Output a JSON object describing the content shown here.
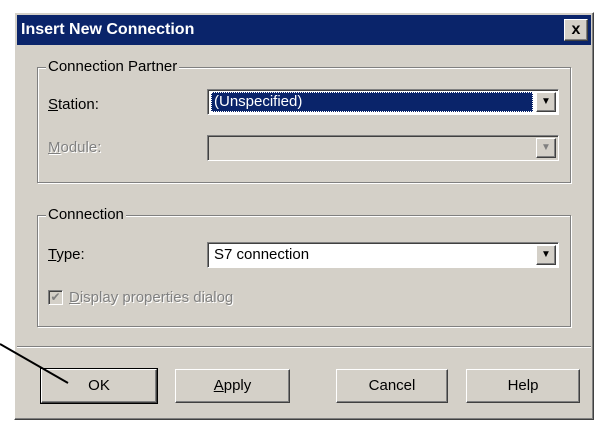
{
  "window": {
    "title": "Insert New Connection",
    "close_glyph": "x"
  },
  "partner_group": {
    "title": "Connection Partner",
    "station": {
      "label_prefix": "",
      "label_access": "S",
      "label_rest": "tation:",
      "value": "(Unspecified)"
    },
    "module": {
      "label_prefix": "",
      "label_access": "M",
      "label_rest": "odule:",
      "value": ""
    }
  },
  "connection_group": {
    "title": "Connection",
    "type": {
      "label_access": "T",
      "label_rest": "ype:",
      "value": "S7 connection"
    },
    "display_props": {
      "label_access": "D",
      "label_rest": "isplay properties dialog",
      "checked": true
    }
  },
  "buttons": {
    "ok": "OK",
    "apply_access": "A",
    "apply_rest": "pply",
    "cancel": "Cancel",
    "help": "Help"
  },
  "icons": {
    "dropdown": "chevron-down-icon",
    "check": "checkmark-icon",
    "close": "close-icon"
  }
}
